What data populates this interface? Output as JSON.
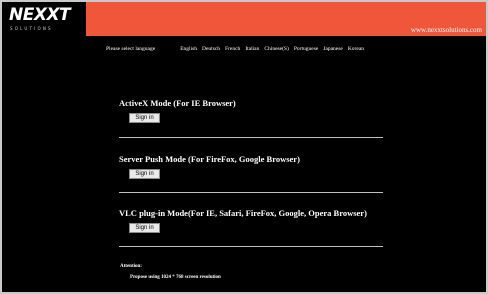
{
  "header": {
    "logo_main": "NEXXT",
    "logo_sub": "SOLUTIONS",
    "site_url": "www.nexxtsolutions.com",
    "bg_color": "#f0573a"
  },
  "language_bar": {
    "prompt": "Please select language",
    "languages": [
      "English",
      "Deutsch",
      "French",
      "Italian",
      "Chinese(S)",
      "Portuguese",
      "Japanese",
      "Korean"
    ]
  },
  "modes": [
    {
      "title": "ActiveX Mode (For IE Browser)",
      "button_label": "Sign in"
    },
    {
      "title": "Server Push Mode (For FireFox, Google Browser)",
      "button_label": "Sign in"
    },
    {
      "title": "VLC plug-in Mode(For IE, Safari, FireFox, Google, Opera Browser)",
      "button_label": "Sign in"
    }
  ],
  "attention": {
    "label": "Attention:",
    "note": "Propose using 1024 * 768 screen resolution"
  }
}
